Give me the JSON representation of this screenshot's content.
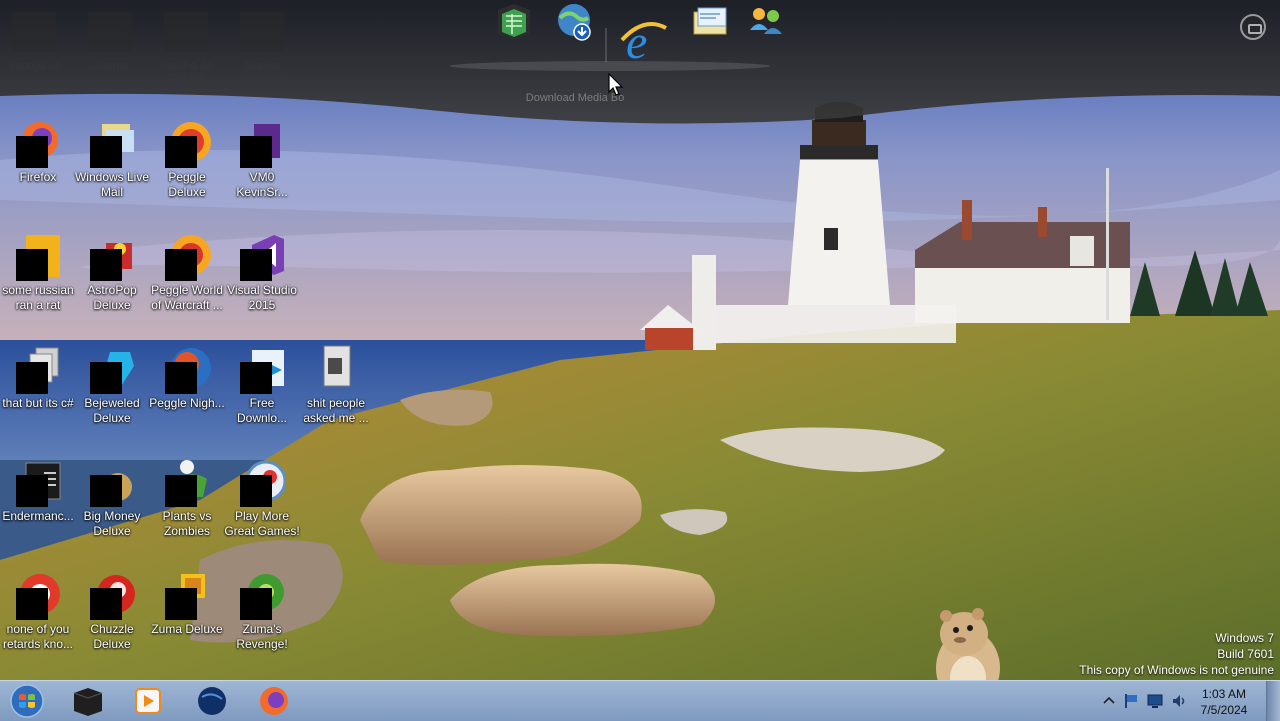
{
  "dock": {
    "tooltip": "Download Media Bo",
    "icons": [
      "spreadsheet-cube-icon",
      "download-globe-icon",
      "internet-explorer-icon",
      "windows-mail-icon",
      "messenger-people-icon"
    ],
    "ghost_labels": [
      "eaoopa uo",
      "Zooma",
      "meaPo de Deluxe",
      "Nopfee Pyamyaa"
    ]
  },
  "desktop_icons": [
    {
      "label": "Firefox",
      "icon": "firefox-icon"
    },
    {
      "label": "Windows Live Mail",
      "icon": "live-mail-icon"
    },
    {
      "label": "Peggle Deluxe",
      "icon": "peggle-icon"
    },
    {
      "label": "VM0 KevinSr...",
      "icon": "vm-icon"
    },
    {
      "label": "some russian ran a rat",
      "icon": "rat-file-icon"
    },
    {
      "label": "AstroPop Deluxe",
      "icon": "astropop-icon"
    },
    {
      "label": "Peggle World of Warcraft ...",
      "icon": "peggle-wow-icon"
    },
    {
      "label": "Visual Studio 2015",
      "icon": "visual-studio-icon"
    },
    {
      "label": "that but its c#",
      "icon": "copy-files-icon"
    },
    {
      "label": "Bejeweled Deluxe",
      "icon": "bejeweled-icon"
    },
    {
      "label": "Peggle Nigh...",
      "icon": "peggle-nights-icon"
    },
    {
      "label": "Free Downlo...",
      "icon": "free-download-icon"
    },
    {
      "label": "shit people asked me ...",
      "icon": "document-icon"
    },
    {
      "label": "Endermanc...",
      "icon": "console-icon"
    },
    {
      "label": "Big Money Deluxe",
      "icon": "big-money-icon"
    },
    {
      "label": "Plants vs Zombies",
      "icon": "pvz-icon"
    },
    {
      "label": "Play More Great Games!",
      "icon": "popcap-icon"
    },
    {
      "label": "none of you retards kno...",
      "icon": "chrome-like-icon"
    },
    {
      "label": "Chuzzle Deluxe",
      "icon": "chuzzle-icon"
    },
    {
      "label": "Zuma Deluxe",
      "icon": "zuma-icon"
    },
    {
      "label": "Zuma's Revenge!",
      "icon": "zuma-revenge-icon"
    }
  ],
  "watermark": {
    "line1": "Windows 7",
    "line2": "Build 7601",
    "line3": "This copy of Windows is not genuine"
  },
  "taskbar": {
    "pinned": [
      "cmd-icon",
      "media-player-icon",
      "globe-icon",
      "firefox-icon"
    ],
    "clock_time": "1:03 AM",
    "clock_date": "7/5/2024"
  }
}
